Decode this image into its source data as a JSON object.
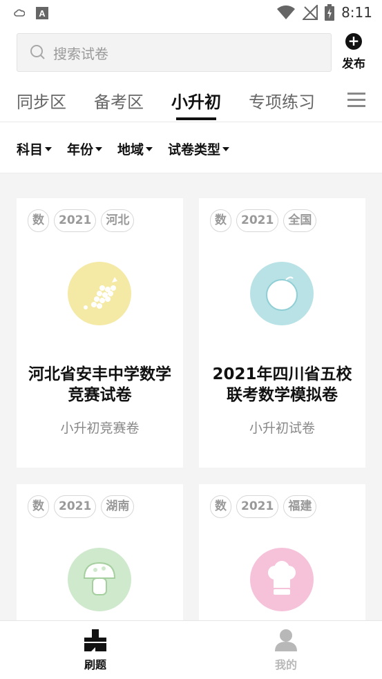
{
  "status_bar": {
    "time": "8:11",
    "icons": [
      "cloud-icon",
      "font-app-icon",
      "wifi-icon",
      "no-signal-icon",
      "battery-charging-icon"
    ]
  },
  "search": {
    "placeholder": "搜索试卷",
    "icon": "search-icon"
  },
  "publish": {
    "label": "发布",
    "icon": "plus-circle-icon"
  },
  "tabs": [
    {
      "label": "同步区",
      "active": false
    },
    {
      "label": "备考区",
      "active": false
    },
    {
      "label": "小升初",
      "active": true
    },
    {
      "label": "专项练习",
      "active": false
    }
  ],
  "filters": [
    {
      "label": "科目"
    },
    {
      "label": "年份"
    },
    {
      "label": "地域"
    },
    {
      "label": "试卷类型"
    }
  ],
  "cards": [
    {
      "tags": [
        "数",
        "2021",
        "河北"
      ],
      "title": "河北省安丰中学数学竞赛试卷",
      "type": "小升初竞赛卷",
      "icon": "grapes-icon",
      "color": "#f5e9a6"
    },
    {
      "tags": [
        "数",
        "2021",
        "全国"
      ],
      "title": "2021年四川省五校联考数学模拟卷",
      "type": "小升初试卷",
      "icon": "melon-icon",
      "color": "#b9e2e6"
    },
    {
      "tags": [
        "数",
        "2021",
        "湖南"
      ],
      "title": "",
      "type": "",
      "icon": "mushroom-icon",
      "color": "#cfe9cc"
    },
    {
      "tags": [
        "数",
        "2021",
        "福建"
      ],
      "title": "",
      "type": "",
      "icon": "chef-hat-icon",
      "color": "#f6c2da"
    }
  ],
  "bottom_nav": [
    {
      "label": "刷题",
      "icon": "brush-icon",
      "active": true
    },
    {
      "label": "我的",
      "icon": "user-icon",
      "active": false
    }
  ],
  "colors": {
    "active_text": "#111111",
    "inactive_text": "#666666",
    "content_bg": "#f4f4f4",
    "nav_inactive": "#b8b8b8"
  }
}
